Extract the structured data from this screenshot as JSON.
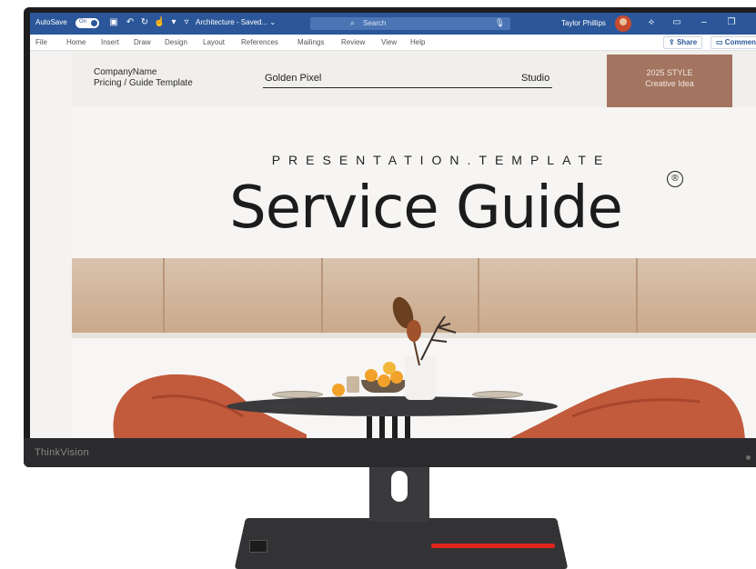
{
  "titlebar": {
    "autosave_label": "AutoSave",
    "toggle_label": "On",
    "document_name": "Architecture - Saved... ⌄",
    "search_placeholder": "Search",
    "user_name": "Taylor Phillips"
  },
  "ribbon": {
    "tabs": [
      {
        "label": "File"
      },
      {
        "label": "Home"
      },
      {
        "label": "Insert"
      },
      {
        "label": "Draw"
      },
      {
        "label": "Design"
      },
      {
        "label": "Layout"
      },
      {
        "label": "References"
      },
      {
        "label": "Mailings"
      },
      {
        "label": "Review"
      },
      {
        "label": "View"
      },
      {
        "label": "Help"
      }
    ],
    "share_label": "Share",
    "comments_label": "Comments"
  },
  "document": {
    "company_line1": "CompanyName",
    "company_line2": "Pricing / Guide Template",
    "golden_pixel": "Golden Pixel",
    "studio": "Studio",
    "style_line1": "2025 STYLE",
    "style_line2": "Creative Idea",
    "subtitle": "PRESENTATION.TEMPLATE",
    "title": "Service Guide",
    "registered_mark": "®"
  },
  "monitor": {
    "brand": "ThinkVision"
  },
  "colors": {
    "word_blue": "#2b579a",
    "style_box": "#a37560",
    "chair": "#c25a3c",
    "stand_stripe": "#e0261c"
  }
}
